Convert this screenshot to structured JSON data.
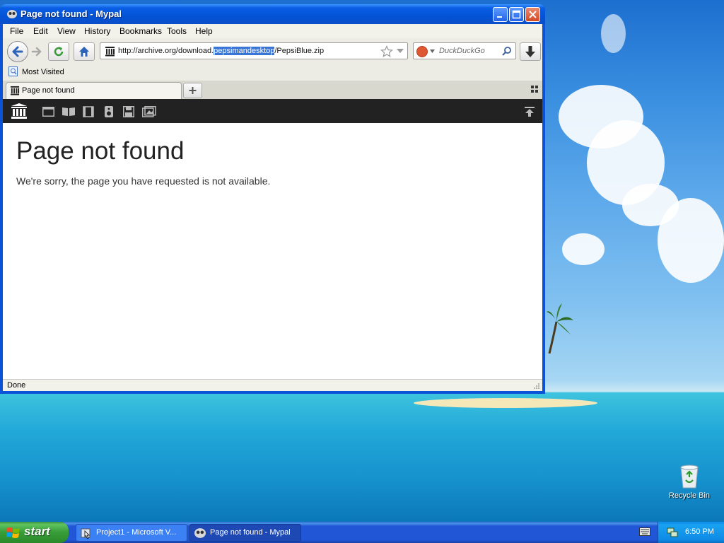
{
  "window": {
    "title": "Page not found - Mypal",
    "app_icon": "mypal-icon"
  },
  "menu": {
    "items": [
      "File",
      "Edit",
      "View",
      "History",
      "Bookmarks",
      "Tools",
      "Help"
    ]
  },
  "address_bar": {
    "url_prefix": "http://archive.org/download.",
    "url_selected": "pepsimandesktop",
    "url_suffix": "/PepsiBlue.zip"
  },
  "search_bar": {
    "placeholder": "DuckDuckGo"
  },
  "bookmarks_bar": {
    "items": [
      "Most Visited"
    ]
  },
  "tabs": [
    {
      "label": "Page not found",
      "active": true
    }
  ],
  "page": {
    "heading": "Page not found",
    "message": "We're sorry, the page you have requested is not available."
  },
  "status_bar": {
    "text": "Done"
  },
  "desktop": {
    "icons": [
      {
        "label": "Recycle Bin",
        "icon": "recycle-bin-icon"
      }
    ]
  },
  "taskbar": {
    "start_label": "start",
    "tasks": [
      {
        "label": "Project1 - Microsoft V...",
        "active": false
      },
      {
        "label": "Page not found - Mypal",
        "active": true
      }
    ],
    "clock": "6:50 PM"
  },
  "colors": {
    "title_bar": "#0353d6",
    "ia_nav_bg": "#222222",
    "start_button": "#379c37",
    "taskbar": "#2157d7"
  }
}
